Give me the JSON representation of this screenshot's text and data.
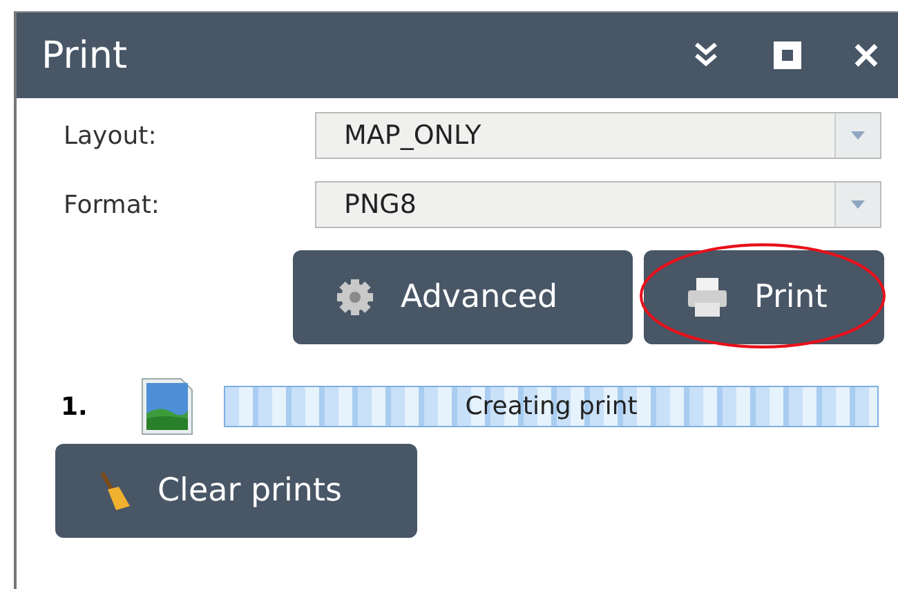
{
  "window": {
    "title": "Print"
  },
  "title_buttons": [
    {
      "kind": "collapse"
    },
    {
      "kind": "maximize"
    },
    {
      "kind": "close"
    }
  ],
  "fields": [
    {
      "label": "Layout:",
      "value": "MAP_ONLY"
    },
    {
      "label": "Format:",
      "value": "PNG8"
    }
  ],
  "buttons": [
    {
      "kind": "advanced",
      "label": "Advanced"
    },
    {
      "kind": "print",
      "label": "Print",
      "highlighted": true
    }
  ],
  "prints": [
    {
      "number": "1.",
      "status": "Creating print",
      "level": 1
    }
  ],
  "clear_button": {
    "label": "Clear prints"
  }
}
